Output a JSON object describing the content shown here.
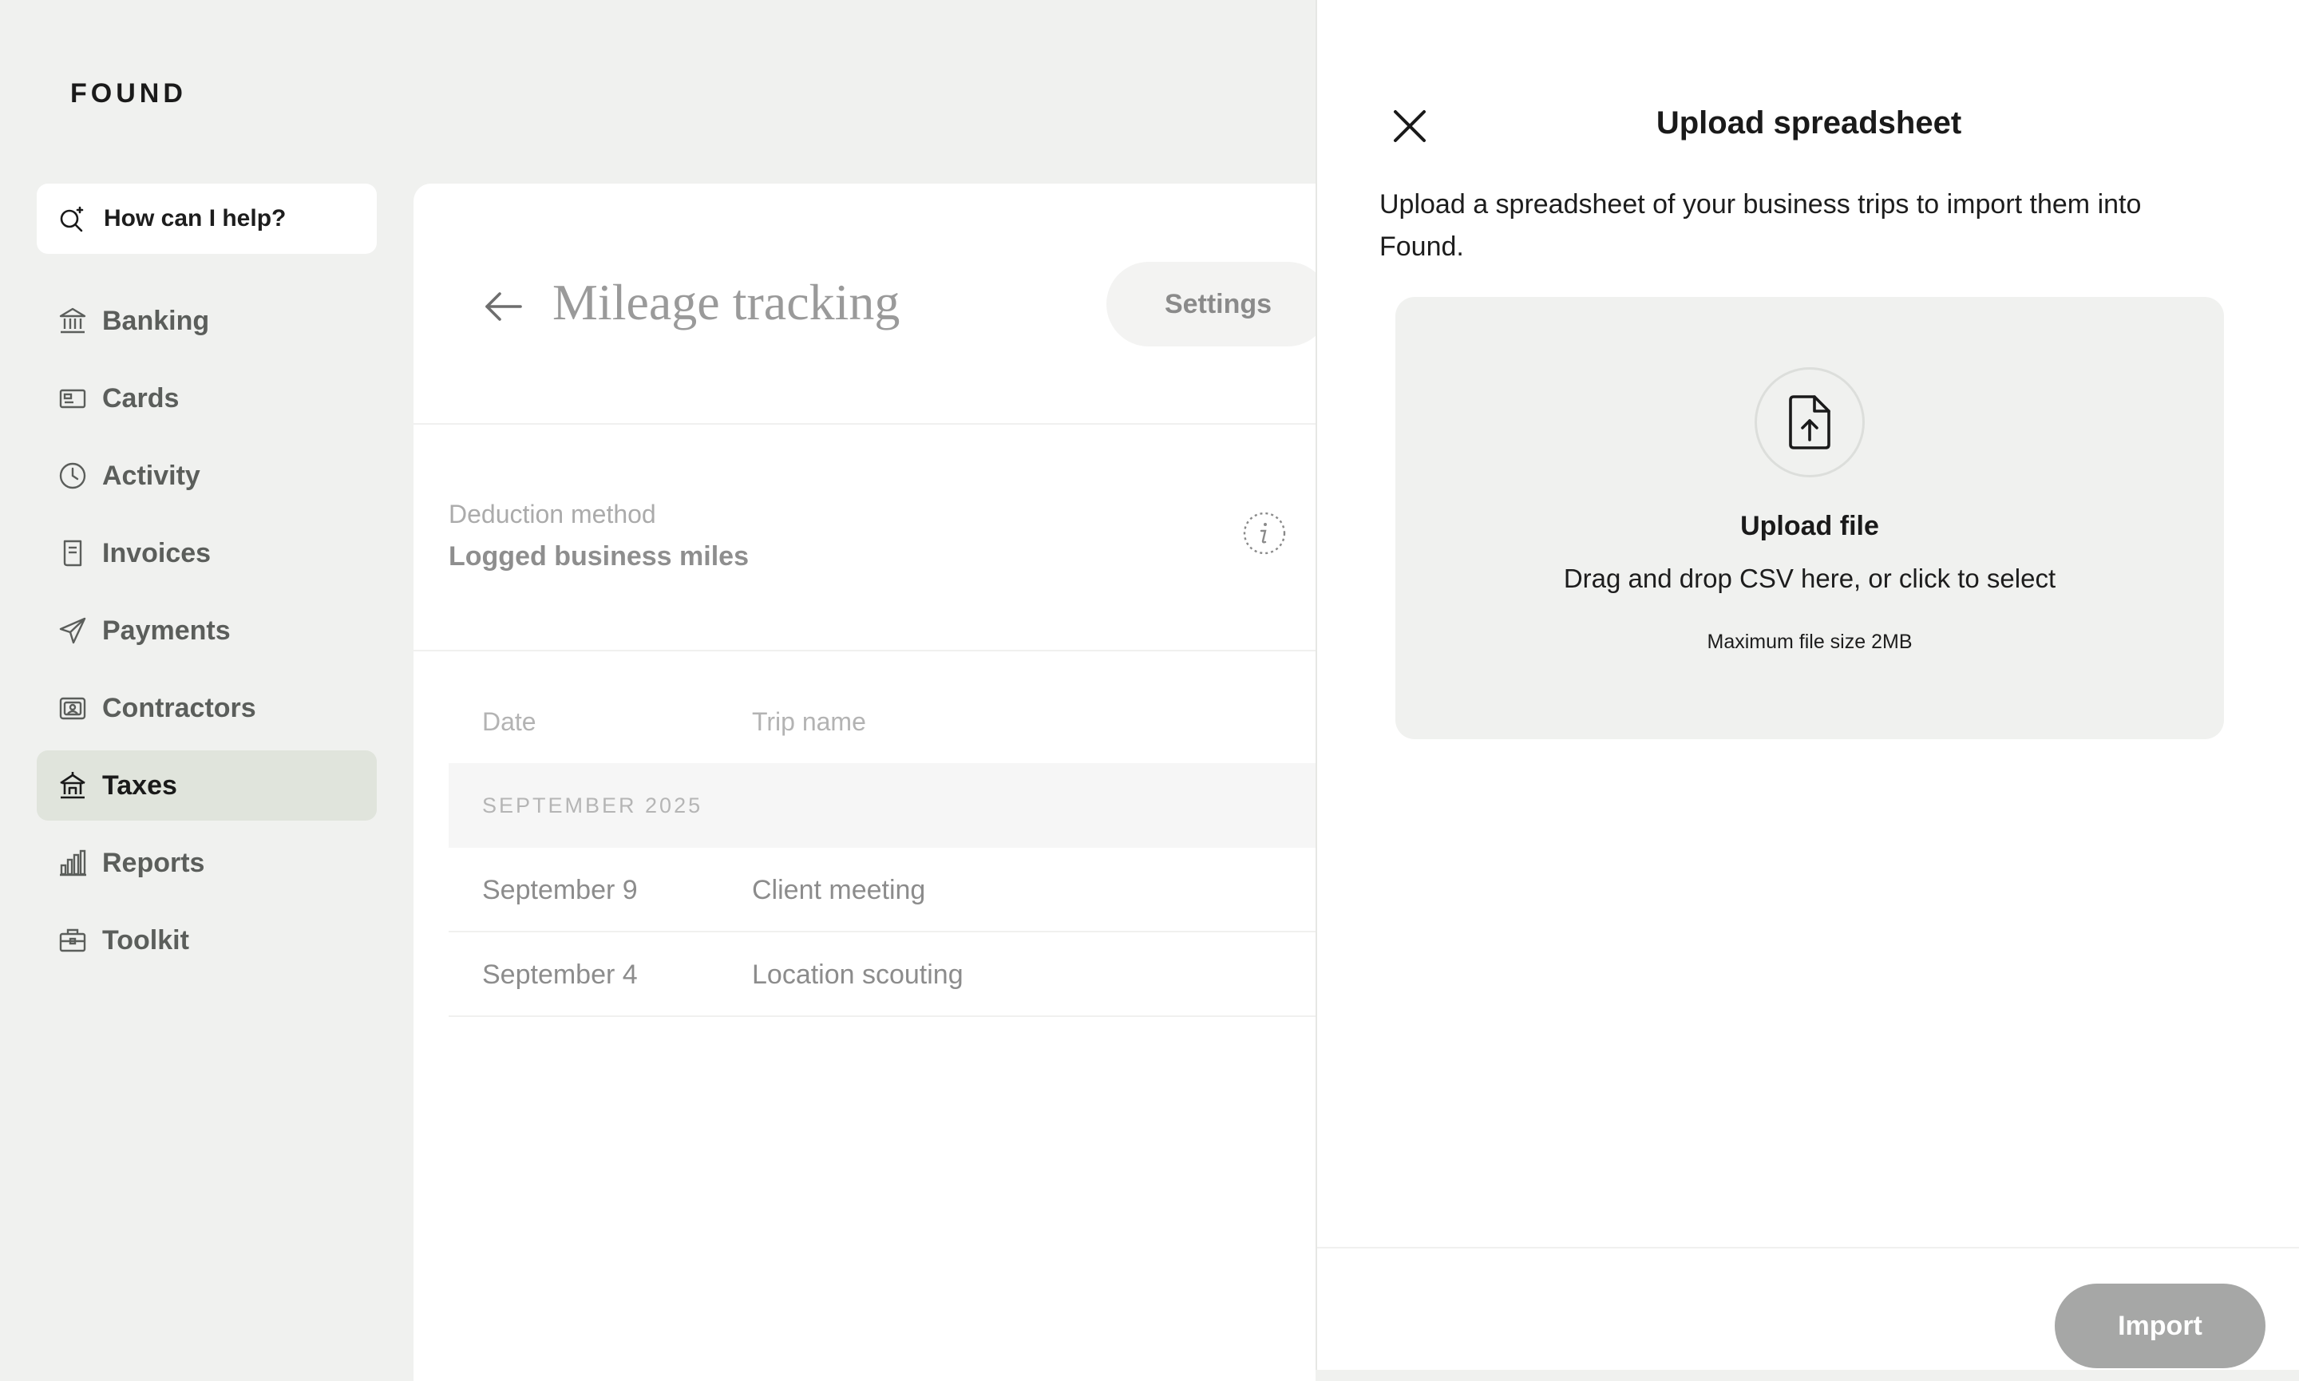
{
  "app": {
    "logo": "FOUND"
  },
  "assistant": {
    "label": "How can I help?"
  },
  "sidebar": {
    "items": [
      {
        "label": "Banking",
        "icon": "bank-icon"
      },
      {
        "label": "Cards",
        "icon": "card-icon"
      },
      {
        "label": "Activity",
        "icon": "clock-icon"
      },
      {
        "label": "Invoices",
        "icon": "invoice-icon"
      },
      {
        "label": "Payments",
        "icon": "paper-plane-icon"
      },
      {
        "label": "Contractors",
        "icon": "contractor-icon"
      },
      {
        "label": "Taxes",
        "icon": "tax-icon",
        "active": true
      },
      {
        "label": "Reports",
        "icon": "bar-chart-icon"
      },
      {
        "label": "Toolkit",
        "icon": "briefcase-icon"
      }
    ]
  },
  "main": {
    "title": "Mileage tracking",
    "settings_label": "Settings",
    "deduction_label": "Deduction method",
    "deduction_value": "Logged business miles",
    "table": {
      "columns": [
        "Date",
        "Trip name"
      ],
      "month": "SEPTEMBER 2025",
      "rows": [
        {
          "date": "September 9",
          "trip": "Client meeting"
        },
        {
          "date": "September 4",
          "trip": "Location scouting"
        }
      ]
    }
  },
  "drawer": {
    "title": "Upload spreadsheet",
    "description": "Upload a spreadsheet of your business trips to import them into Found.",
    "upload": {
      "title": "Upload file",
      "subtitle": "Drag and drop CSV here, or click to select",
      "max_size": "Maximum file size 2MB"
    },
    "import_label": "Import"
  },
  "colors": {
    "background": "#f0f1ef",
    "active_nav": "#e0e4dc",
    "import_button": "#a6a7a6"
  }
}
